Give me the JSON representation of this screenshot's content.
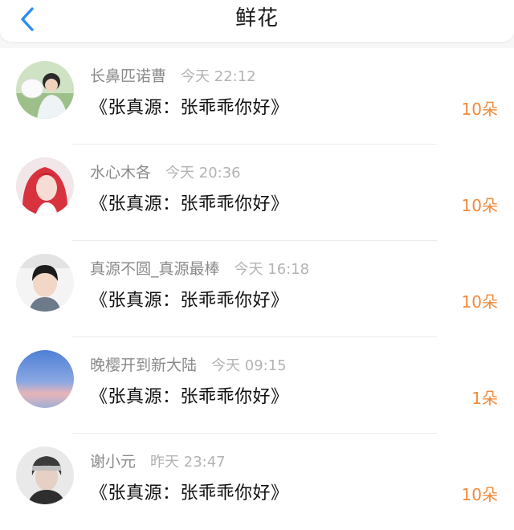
{
  "header": {
    "title": "鲜花",
    "back_icon": "chevron-left-icon",
    "accent_color": "#2f8cf2"
  },
  "gift_count_color": "#f08a3c",
  "items": [
    {
      "username": "长鼻匹诺曹",
      "time": "今天 22:12",
      "book": "《张真源：张乖乖你好》",
      "count": "10朵"
    },
    {
      "username": "水心木各",
      "time": "今天 20:36",
      "book": "《张真源：张乖乖你好》",
      "count": "10朵"
    },
    {
      "username": "真源不圆_真源最棒",
      "time": "今天 16:18",
      "book": "《张真源：张乖乖你好》",
      "count": "10朵"
    },
    {
      "username": "晚樱开到新大陆",
      "time": "今天 09:15",
      "book": "《张真源：张乖乖你好》",
      "count": "1朵"
    },
    {
      "username": "谢小元",
      "time": "昨天 23:47",
      "book": "《张真源：张乖乖你好》",
      "count": "10朵"
    }
  ]
}
